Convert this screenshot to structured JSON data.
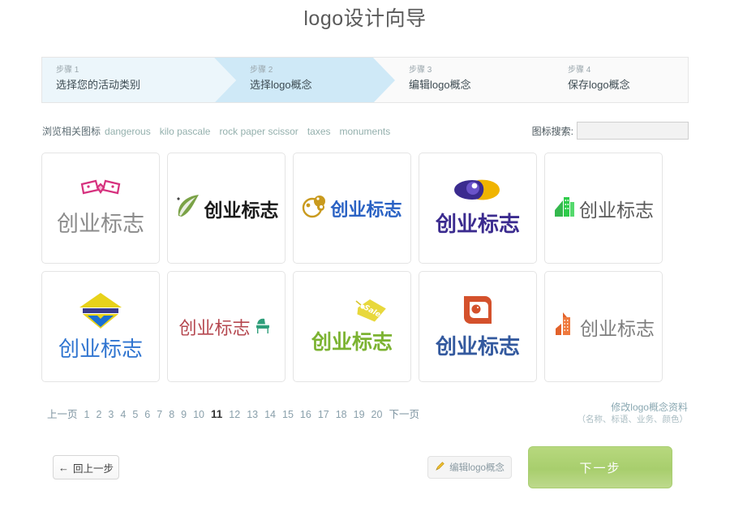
{
  "header": {
    "title": "logo设计向导"
  },
  "steps": [
    {
      "num": "步骤 1",
      "label": "选择您的活动类别",
      "state": "done"
    },
    {
      "num": "步骤 2",
      "label": "选择logo概念",
      "state": "active"
    },
    {
      "num": "步骤 3",
      "label": "编辑logo概念",
      "state": "upcoming"
    },
    {
      "num": "步骤 4",
      "label": "保存logo概念",
      "state": "upcoming"
    }
  ],
  "tags": {
    "label": "浏览相关图标",
    "items": [
      "dangerous",
      "kilo pascale",
      "rock paper scissor",
      "taxes",
      "monuments"
    ]
  },
  "search": {
    "label": "图标搜索:",
    "value": "",
    "placeholder": ""
  },
  "logos": [
    {
      "text": "创业标志",
      "text_color": "#8b8b8b",
      "icon": "ribbon-bowtie-icon",
      "icon_color": "#d6317e",
      "layout": "stack"
    },
    {
      "text": "创业标志",
      "text_color": "#1a1a1a",
      "icon": "leaf-swoosh-icon",
      "icon_color": "#6f9b3f",
      "layout": "row"
    },
    {
      "text": "创业标志",
      "text_color": "#2a62c4",
      "icon": "circle-gear-icon",
      "icon_color": "#c99a1e",
      "layout": "row"
    },
    {
      "text": "创业标志",
      "text_color": "#3b2b8f",
      "icon": "eye-oval-icon",
      "icon_color": "#4b2f9e",
      "icon_color2": "#f0b400",
      "layout": "stack"
    },
    {
      "text": "创业标志",
      "text_color": "#595959",
      "icon": "green-buildings-icon",
      "icon_color": "#2ecc4a",
      "layout": "row"
    },
    {
      "text": "创业标志",
      "text_color": "#2f74d0",
      "icon": "yellow-house-icon",
      "icon_color": "#e8d21a",
      "icon_color2": "#1a6fd4",
      "layout": "stack"
    },
    {
      "text": "创业标志",
      "text_color": "#b5474f",
      "icon": "green-chair-icon",
      "icon_color": "#2f9e7a",
      "layout": "row-reverse"
    },
    {
      "text": "创业标志",
      "text_color": "#7cb332",
      "icon": "sales-tag-icon",
      "icon_color": "#e8d83c",
      "layout": "stack-tag"
    },
    {
      "text": "创业标志",
      "text_color": "#33599e",
      "icon": "orange-book-icon",
      "icon_color": "#d4512c",
      "layout": "stack"
    },
    {
      "text": "创业标志",
      "text_color": "#7d7d7d",
      "icon": "orange-tower-icon",
      "icon_color": "#e2622b",
      "layout": "row"
    }
  ],
  "pagination": {
    "prev": "上一页",
    "next": "下一页",
    "pages": [
      "1",
      "2",
      "3",
      "4",
      "5",
      "6",
      "7",
      "8",
      "9",
      "10",
      "11",
      "12",
      "13",
      "14",
      "15",
      "16",
      "17",
      "18",
      "19",
      "20"
    ],
    "current": "11"
  },
  "modify": {
    "link": "修改logo概念资料",
    "sub": "（名称、标语、业务、颜色）"
  },
  "footer": {
    "back": "回上一步",
    "back_arrow": "←",
    "edit": "编辑logo概念",
    "next": "下一步"
  },
  "colors": {
    "step_active": "#cfe9f7",
    "step_done": "#ecf6fb",
    "next_button": "#a8ce6d",
    "tag_link": "#94b0ad"
  }
}
